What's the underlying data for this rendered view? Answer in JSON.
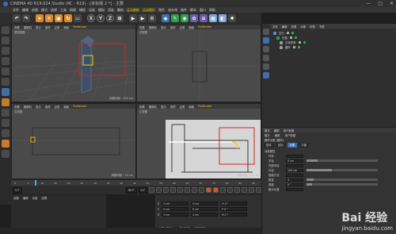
{
  "window": {
    "title": "CINEMA 4D R19.024 Studio (RC - R19) - [未标题 2 *] - 主要",
    "controls": [
      "—",
      "□",
      "✕"
    ]
  },
  "menubar": {
    "items": [
      "文件",
      "编辑",
      "创建",
      "模式",
      "选择",
      "工具",
      "网格",
      "捕捉",
      "动画",
      "模拟",
      "渲染",
      "雕刻",
      "运动跟踪",
      "运动图形",
      "角色",
      "流水线",
      "插件",
      "脚本",
      "窗口",
      "帮助"
    ]
  },
  "toolbar": {
    "axis_labels": [
      "X",
      "Y",
      "Z"
    ]
  },
  "viewports": [
    {
      "name": "透视视图",
      "menu": [
        "查看",
        "摄像机",
        "显示",
        "选项",
        "过滤",
        "面板",
        "ProRender"
      ],
      "scale": "网格间距 : 100 cm"
    },
    {
      "name": "顶视图",
      "menu": [
        "查看",
        "摄像机",
        "显示",
        "选项",
        "过滤",
        "面板",
        "ProRender"
      ],
      "scale": ""
    },
    {
      "name": "右视图",
      "menu": [
        "查看",
        "摄像机",
        "显示",
        "选项",
        "过滤",
        "面板",
        "ProRender"
      ],
      "scale": "网格间距 : 10 cm"
    },
    {
      "name": "正视图",
      "menu": [
        "查看",
        "摄像机",
        "显示",
        "选项",
        "过滤",
        "面板",
        "ProRender"
      ],
      "scale": "网格间距 : 10 cm"
    }
  ],
  "object_manager": {
    "tabs": [
      "文件",
      "编辑",
      "查看",
      "对象",
      "标签",
      "书签"
    ],
    "objects": [
      "空白",
      "扫描",
      "文本样条",
      "圆环"
    ]
  },
  "attributes": {
    "tabs": [
      "模式",
      "编辑",
      "用户数据"
    ],
    "menu": [
      "模式",
      "编辑",
      "用户数据"
    ],
    "object_name": "圆环对象 [圆环]",
    "subtabs": [
      "基本",
      "坐标",
      "对象",
      "平面"
    ],
    "section": "对象属性",
    "rows": [
      {
        "label": "环状",
        "value": ""
      },
      {
        "label": "半径",
        "value": "5 cm"
      },
      {
        "label": "内部半径",
        "value": ""
      },
      {
        "label": "半径",
        "value": "100 cm"
      },
      {
        "label": "插值方式",
        "value": ""
      },
      {
        "label": "数量",
        "value": "4"
      },
      {
        "label": "角度",
        "value": "5 °"
      },
      {
        "label": "最大长度",
        "value": ""
      }
    ]
  },
  "timeline": {
    "ticks": [
      "0",
      "5",
      "10",
      "15",
      "20",
      "25",
      "30",
      "35",
      "40",
      "45",
      "50",
      "55",
      "60",
      "65",
      "70",
      "75",
      "80",
      "85",
      "90"
    ],
    "frame_start": "0 F",
    "frame_end": "90 F",
    "frame_current": "0 F"
  },
  "material_panel": {
    "menu": [
      "创建",
      "编辑",
      "功能",
      "纹理"
    ]
  },
  "coord_panel": {
    "rows": [
      {
        "axis": "X",
        "pos": "0 cm",
        "size": "0 cm",
        "rot": "H 0 °"
      },
      {
        "axis": "Y",
        "pos": "0 cm",
        "size": "0 cm",
        "rot": "P 0 °"
      },
      {
        "axis": "Z",
        "pos": "0 cm",
        "size": "0 cm",
        "rot": "B 0 °"
      }
    ],
    "mode": "对象 (相对)",
    "size_mode": "绝对尺寸",
    "apply": "应用"
  },
  "watermark": {
    "main": "Bai 经验",
    "sub": "jingyan.baidu.com"
  },
  "colors": {
    "highlight_box": "#e02020",
    "selection": "#f4d000",
    "accent": "#3d6fb6"
  }
}
